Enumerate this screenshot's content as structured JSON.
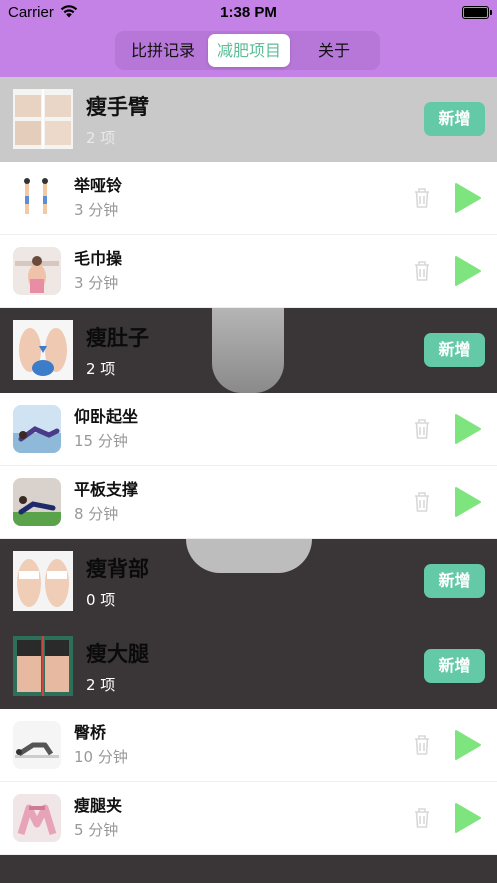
{
  "status_bar": {
    "carrier": "Carrier",
    "time": "1:38 PM"
  },
  "tabs": [
    {
      "label": "比拼记录",
      "selected": false
    },
    {
      "label": "减肥项目",
      "selected": true
    },
    {
      "label": "关于",
      "selected": false
    }
  ],
  "colors": {
    "header": "#c481e6",
    "accent": "#5cbd98",
    "add_button": "#63c9a6",
    "play": "#7ee57e"
  },
  "sections": [
    {
      "title": "瘦手臂",
      "count": "2 项",
      "add_label": "新增",
      "items": [
        {
          "name": "举哑铃",
          "duration": "3 分钟"
        },
        {
          "name": "毛巾操",
          "duration": "3 分钟"
        }
      ]
    },
    {
      "title": "瘦肚子",
      "count": "2 项",
      "add_label": "新增",
      "items": [
        {
          "name": "仰卧起坐",
          "duration": "15 分钟"
        },
        {
          "name": "平板支撑",
          "duration": "8 分钟"
        }
      ]
    },
    {
      "title": "瘦背部",
      "count": "0 项",
      "add_label": "新增",
      "items": []
    },
    {
      "title": "瘦大腿",
      "count": "2 项",
      "add_label": "新增",
      "items": [
        {
          "name": "臀桥",
          "duration": "10 分钟"
        },
        {
          "name": "瘦腿夹",
          "duration": "5 分钟"
        }
      ]
    }
  ]
}
